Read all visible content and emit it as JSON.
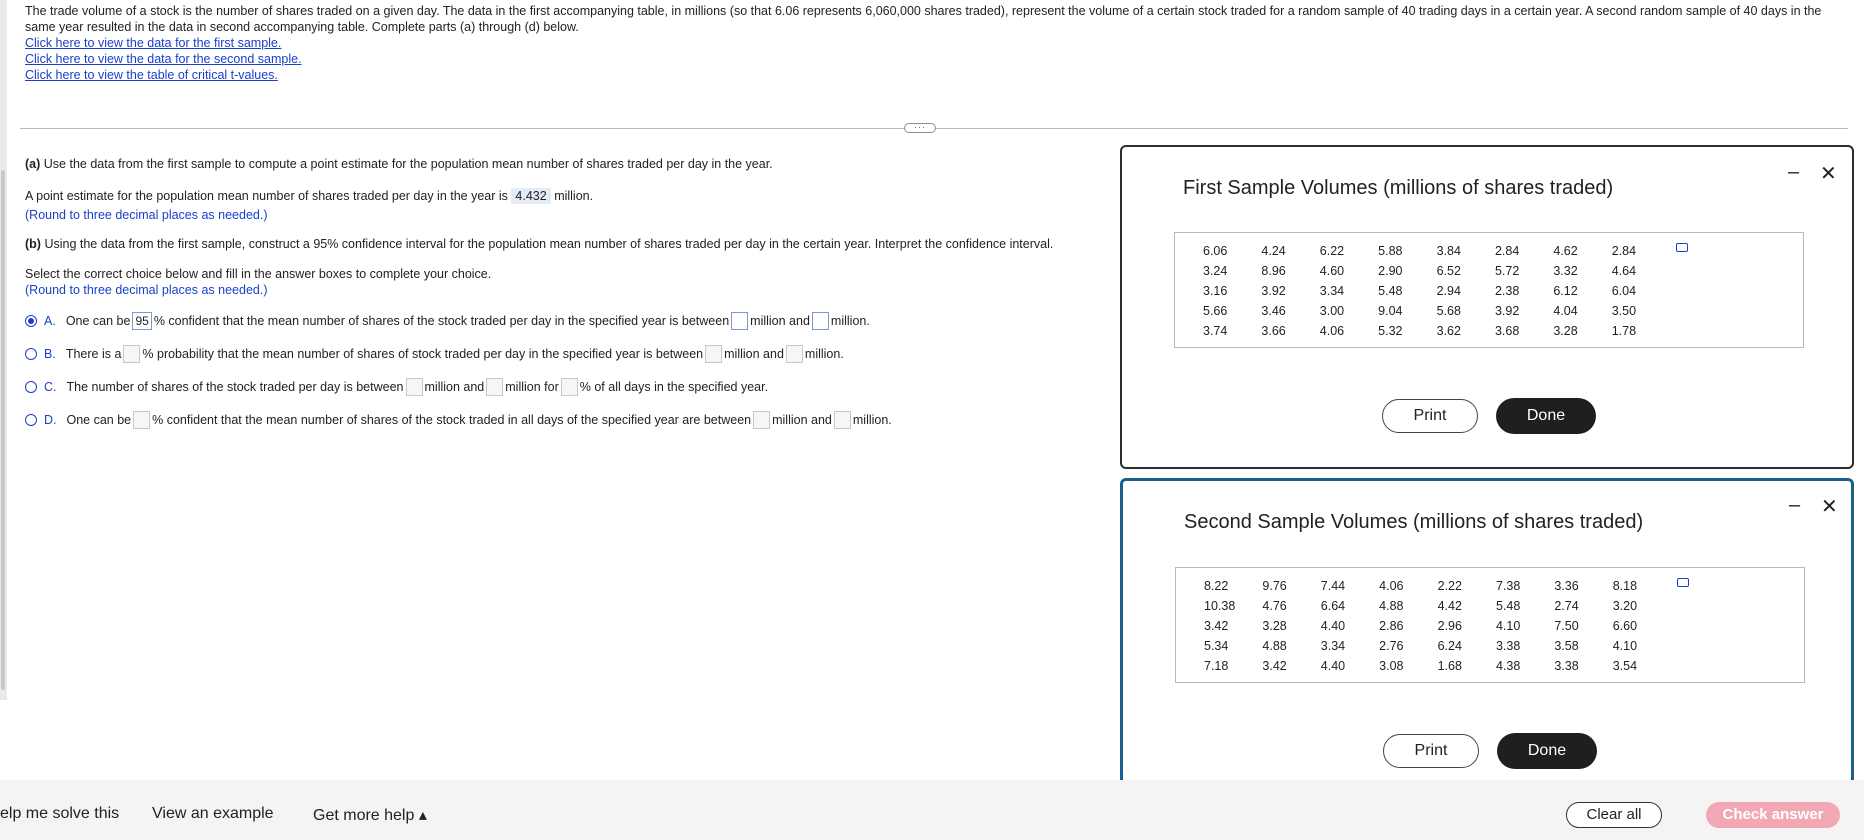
{
  "problem": {
    "text": "The trade volume of a stock is the number of shares traded on a given day. The data in the first accompanying table, in millions (so that 6.06 represents 6,060,000 shares traded), represent the volume of a certain stock traded for a random sample of 40 trading days in a certain year. A second random sample of 40 days in the same year resulted in the data in second accompanying table. Complete parts (a) through (d) below.",
    "links": [
      "Click here to view the data for the first sample.",
      "Click here to view the data for the second sample.",
      "Click here to view the table of critical t-values."
    ]
  },
  "part_a": {
    "label": "(a)",
    "prompt": "Use the data from the first sample to compute a point estimate for the population mean number of shares traded per day in the year.",
    "answer_prefix": "A point estimate for the population mean number of shares traded per day in the year is",
    "answer_value": "4.432",
    "answer_suffix": "million.",
    "round_hint": "(Round to three decimal places as needed.)"
  },
  "part_b": {
    "label": "(b)",
    "prompt": "Using the data from the first sample, construct a 95% confidence interval for the population mean number of shares traded per day in the certain year. Interpret the confidence interval.",
    "instruction": "Select the correct choice below and fill in the answer boxes to complete your choice.",
    "round_hint": "(Round to three decimal places as needed.)",
    "choices": [
      {
        "letter": "A.",
        "t1": "One can be",
        "box1": "95",
        "t2": "% confident that the mean number of shares of the stock traded per day in the specified year is between",
        "t3": "million and",
        "t4": "million."
      },
      {
        "letter": "B.",
        "t1": "There is a",
        "t2": "% probability that the mean number of shares of stock traded per day in the specified year is between",
        "t3": "million and",
        "t4": "million."
      },
      {
        "letter": "C.",
        "t1": "The number of shares of the stock traded per day is between",
        "t2": "million and",
        "t3": "million for",
        "t4": "% of all days in the specified year."
      },
      {
        "letter": "D.",
        "t1": "One can be",
        "t2": "% confident that the mean number of shares of the stock traded in all days of the specified year are between",
        "t3": "million and",
        "t4": "million."
      }
    ]
  },
  "panel1": {
    "title": "First Sample Volumes (millions of shares traded)",
    "rows": [
      [
        "6.06",
        "4.24",
        "6.22",
        "5.88",
        "3.84",
        "2.84",
        "4.62",
        "2.84"
      ],
      [
        "3.24",
        "8.96",
        "4.60",
        "2.90",
        "6.52",
        "5.72",
        "3.32",
        "4.64"
      ],
      [
        "3.16",
        "3.92",
        "3.34",
        "5.48",
        "2.94",
        "2.38",
        "6.12",
        "6.04"
      ],
      [
        "5.66",
        "3.46",
        "3.00",
        "9.04",
        "5.68",
        "3.92",
        "4.04",
        "3.50"
      ],
      [
        "3.74",
        "3.66",
        "4.06",
        "5.32",
        "3.62",
        "3.68",
        "3.28",
        "1.78"
      ]
    ],
    "print_label": "Print",
    "done_label": "Done",
    "minimize": "–",
    "close": "✕"
  },
  "panel2": {
    "title": "Second Sample Volumes (millions of shares traded)",
    "rows": [
      [
        "8.22",
        "9.76",
        "7.44",
        "4.06",
        "2.22",
        "7.38",
        "3.36",
        "8.18"
      ],
      [
        "10.38",
        "4.76",
        "6.64",
        "4.88",
        "4.42",
        "5.48",
        "2.74",
        "3.20"
      ],
      [
        "3.42",
        "3.28",
        "4.40",
        "2.86",
        "2.96",
        "4.10",
        "7.50",
        "6.60"
      ],
      [
        "5.34",
        "4.88",
        "3.34",
        "2.76",
        "6.24",
        "3.38",
        "3.58",
        "4.10"
      ],
      [
        "7.18",
        "3.42",
        "4.40",
        "3.08",
        "1.68",
        "4.38",
        "3.38",
        "3.54"
      ]
    ],
    "print_label": "Print",
    "done_label": "Done",
    "minimize": "–",
    "close": "✕"
  },
  "footer": {
    "help_solve": "elp me solve this",
    "view_example": "View an example",
    "more_help": "Get more help ▴",
    "clear_all": "Clear all",
    "check_answer": "Check answer"
  },
  "colors": {
    "link": "#1a3fcc",
    "active_panel_border": "#1d5f8a",
    "check_answer_bg": "#f2a8b4"
  }
}
